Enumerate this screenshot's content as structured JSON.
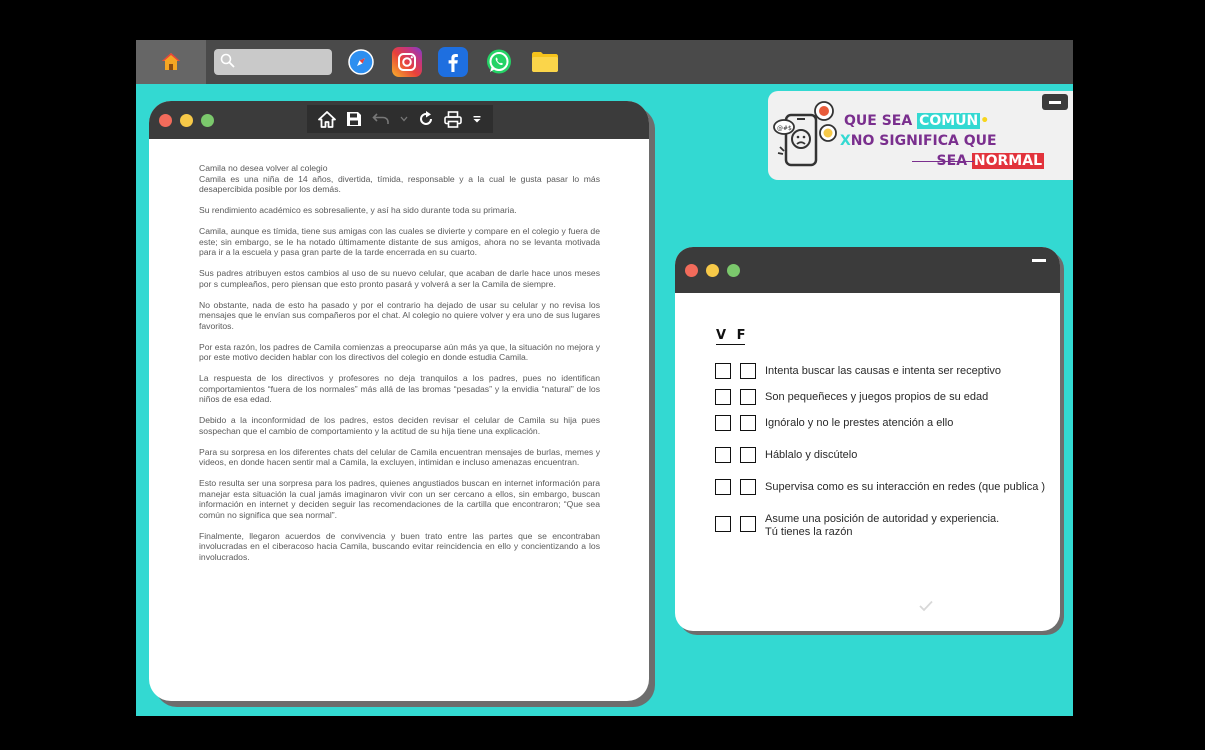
{
  "taskbar": {
    "icons": [
      "home-icon",
      "search-icon",
      "safari-icon",
      "instagram-icon",
      "facebook-icon",
      "whatsapp-icon",
      "folder-icon"
    ],
    "search_value": "",
    "colors": {
      "bar": "#4a4a4a",
      "home_tile": "#666666",
      "search": "#c9c9c9"
    }
  },
  "document_window": {
    "toolbar_icons": [
      "home-icon",
      "save-icon",
      "undo-icon",
      "chevron-down-icon",
      "redo-icon",
      "print-icon",
      "menu-caret-icon"
    ],
    "paragraphs": [
      "Camila no desea volver al colegio",
      "Camila es una niña de 14 años, divertida, tímida, responsable y a la cual le gusta pasar lo más desapercibida posible por los demás.",
      "Su rendimiento académico es sobresaliente, y así ha sido durante toda su primaria.",
      "Camila, aunque es tímida, tiene sus amigas con las cuales se divierte y compare en el colegio y fuera de este; sin embargo, se le ha notado últimamente distante de sus amigos, ahora no se levanta motivada para ir a la escuela y pasa gran parte de la tarde encerrada en su cuarto.",
      "Sus padres atribuyen estos cambios al uso de su nuevo celular, que acaban de darle hace unos meses por s cumpleaños, pero piensan que esto pronto pasará y volverá a ser la Camila de siempre.",
      "No obstante, nada de esto ha pasado y por el contrario ha dejado de usar su celular y no revisa los mensajes que le envían sus compañeros por el chat. Al colegio no quiere volver y era uno de sus lugares favoritos.",
      "Por esta razón, los padres de Camila comienzas a preocuparse aún más ya que, la situación no mejora y por este motivo deciden hablar con los directivos del colegio en donde estudia Camila.",
      "La respuesta de los directivos y profesores no deja tranquilos a los padres, pues no identifican comportamientos “fuera de los normales” más allá de las bromas “pesadas” y la envidia “natural” de los niños de esa edad.",
      "Debido a la inconformidad de los padres, estos deciden revisar el celular de Camila su hija pues sospechan que el cambio de comportamiento y la actitud de su hija tiene una explicación.",
      "Para su sorpresa en los diferentes chats del celular de Camila encuentran mensajes de burlas, memes y videos, en donde hacen sentir mal a Camila, la excluyen, intimidan e incluso amenazas encuentran.",
      "Esto resulta ser una sorpresa para los padres, quienes angustiados buscan en internet información para manejar esta situación la cual jamás imaginaron vivir con un ser cercano a ellos, sin embargo, buscan información en internet y deciden seguir las recomendaciones de la cartilla que encontraron; “Que sea común no significa que sea normal”.",
      "Finalmente, llegaron acuerdos de convivencia y buen trato entre las partes que se encontraban involucradas en el ciberacoso hacia Camila, buscando evitar reincidencia en ello y concientizando a los involucrados."
    ]
  },
  "banner": {
    "line1_a": "QUE SEA ",
    "line1_hl": "COMÚN",
    "line1_dot": "•",
    "line2_x": "X",
    "line2_text": "NO SIGNIFICA QUE",
    "line3_a": "SEA ",
    "line3_hl": "NORMAL",
    "colors": {
      "purple": "#7a2f8e",
      "cyan": "#34d9d2",
      "red": "#e2333c"
    }
  },
  "quiz_window": {
    "header_v": "V",
    "header_f": "F",
    "statements": [
      {
        "line1": "Intenta buscar las causas e intenta ser receptivo",
        "line2": ""
      },
      {
        "line1": "Son pequeñeces y juegos propios de su edad",
        "line2": ""
      },
      {
        "line1": "Ignóralo y no le prestes atención a ello",
        "line2": ""
      },
      {
        "line1": "Háblalo y discútelo",
        "line2": ""
      },
      {
        "line1": "Supervisa como es su interacción en redes (que publica )",
        "line2": ""
      },
      {
        "line1": "Asume una posición de autoridad y experiencia.",
        "line2": "Tú tienes la razón"
      }
    ],
    "submit_icon": "checkmark-icon"
  },
  "window_dot_colors": {
    "red": "#f26b5b",
    "yellow": "#f7c948",
    "green": "#7bc86c"
  }
}
